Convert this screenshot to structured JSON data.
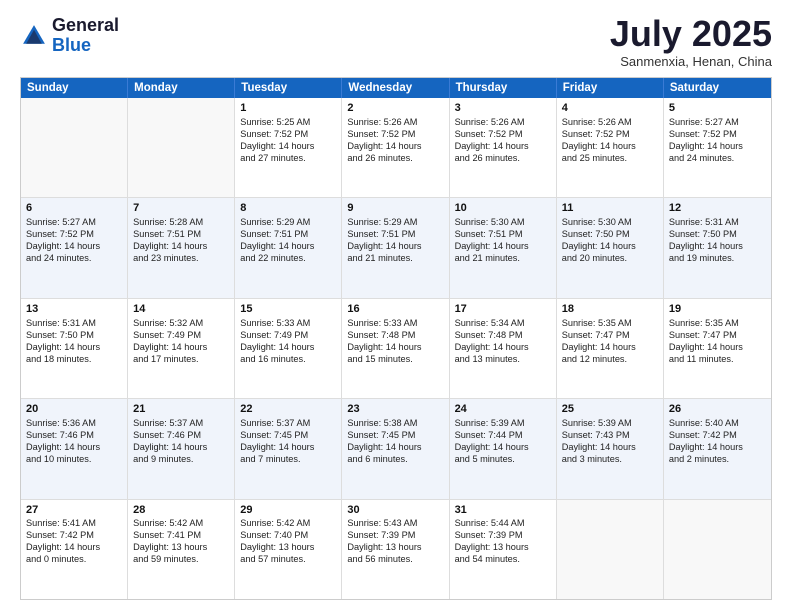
{
  "header": {
    "logo_general": "General",
    "logo_blue": "Blue",
    "month_title": "July 2025",
    "location": "Sanmenxia, Henan, China"
  },
  "days_of_week": [
    "Sunday",
    "Monday",
    "Tuesday",
    "Wednesday",
    "Thursday",
    "Friday",
    "Saturday"
  ],
  "rows": [
    [
      {
        "day": "",
        "empty": true
      },
      {
        "day": "",
        "empty": true
      },
      {
        "day": "1",
        "lines": [
          "Sunrise: 5:25 AM",
          "Sunset: 7:52 PM",
          "Daylight: 14 hours",
          "and 27 minutes."
        ]
      },
      {
        "day": "2",
        "lines": [
          "Sunrise: 5:26 AM",
          "Sunset: 7:52 PM",
          "Daylight: 14 hours",
          "and 26 minutes."
        ]
      },
      {
        "day": "3",
        "lines": [
          "Sunrise: 5:26 AM",
          "Sunset: 7:52 PM",
          "Daylight: 14 hours",
          "and 26 minutes."
        ]
      },
      {
        "day": "4",
        "lines": [
          "Sunrise: 5:26 AM",
          "Sunset: 7:52 PM",
          "Daylight: 14 hours",
          "and 25 minutes."
        ]
      },
      {
        "day": "5",
        "lines": [
          "Sunrise: 5:27 AM",
          "Sunset: 7:52 PM",
          "Daylight: 14 hours",
          "and 24 minutes."
        ]
      }
    ],
    [
      {
        "day": "6",
        "lines": [
          "Sunrise: 5:27 AM",
          "Sunset: 7:52 PM",
          "Daylight: 14 hours",
          "and 24 minutes."
        ]
      },
      {
        "day": "7",
        "lines": [
          "Sunrise: 5:28 AM",
          "Sunset: 7:51 PM",
          "Daylight: 14 hours",
          "and 23 minutes."
        ]
      },
      {
        "day": "8",
        "lines": [
          "Sunrise: 5:29 AM",
          "Sunset: 7:51 PM",
          "Daylight: 14 hours",
          "and 22 minutes."
        ]
      },
      {
        "day": "9",
        "lines": [
          "Sunrise: 5:29 AM",
          "Sunset: 7:51 PM",
          "Daylight: 14 hours",
          "and 21 minutes."
        ]
      },
      {
        "day": "10",
        "lines": [
          "Sunrise: 5:30 AM",
          "Sunset: 7:51 PM",
          "Daylight: 14 hours",
          "and 21 minutes."
        ]
      },
      {
        "day": "11",
        "lines": [
          "Sunrise: 5:30 AM",
          "Sunset: 7:50 PM",
          "Daylight: 14 hours",
          "and 20 minutes."
        ]
      },
      {
        "day": "12",
        "lines": [
          "Sunrise: 5:31 AM",
          "Sunset: 7:50 PM",
          "Daylight: 14 hours",
          "and 19 minutes."
        ]
      }
    ],
    [
      {
        "day": "13",
        "lines": [
          "Sunrise: 5:31 AM",
          "Sunset: 7:50 PM",
          "Daylight: 14 hours",
          "and 18 minutes."
        ]
      },
      {
        "day": "14",
        "lines": [
          "Sunrise: 5:32 AM",
          "Sunset: 7:49 PM",
          "Daylight: 14 hours",
          "and 17 minutes."
        ]
      },
      {
        "day": "15",
        "lines": [
          "Sunrise: 5:33 AM",
          "Sunset: 7:49 PM",
          "Daylight: 14 hours",
          "and 16 minutes."
        ]
      },
      {
        "day": "16",
        "lines": [
          "Sunrise: 5:33 AM",
          "Sunset: 7:48 PM",
          "Daylight: 14 hours",
          "and 15 minutes."
        ]
      },
      {
        "day": "17",
        "lines": [
          "Sunrise: 5:34 AM",
          "Sunset: 7:48 PM",
          "Daylight: 14 hours",
          "and 13 minutes."
        ]
      },
      {
        "day": "18",
        "lines": [
          "Sunrise: 5:35 AM",
          "Sunset: 7:47 PM",
          "Daylight: 14 hours",
          "and 12 minutes."
        ]
      },
      {
        "day": "19",
        "lines": [
          "Sunrise: 5:35 AM",
          "Sunset: 7:47 PM",
          "Daylight: 14 hours",
          "and 11 minutes."
        ]
      }
    ],
    [
      {
        "day": "20",
        "lines": [
          "Sunrise: 5:36 AM",
          "Sunset: 7:46 PM",
          "Daylight: 14 hours",
          "and 10 minutes."
        ]
      },
      {
        "day": "21",
        "lines": [
          "Sunrise: 5:37 AM",
          "Sunset: 7:46 PM",
          "Daylight: 14 hours",
          "and 9 minutes."
        ]
      },
      {
        "day": "22",
        "lines": [
          "Sunrise: 5:37 AM",
          "Sunset: 7:45 PM",
          "Daylight: 14 hours",
          "and 7 minutes."
        ]
      },
      {
        "day": "23",
        "lines": [
          "Sunrise: 5:38 AM",
          "Sunset: 7:45 PM",
          "Daylight: 14 hours",
          "and 6 minutes."
        ]
      },
      {
        "day": "24",
        "lines": [
          "Sunrise: 5:39 AM",
          "Sunset: 7:44 PM",
          "Daylight: 14 hours",
          "and 5 minutes."
        ]
      },
      {
        "day": "25",
        "lines": [
          "Sunrise: 5:39 AM",
          "Sunset: 7:43 PM",
          "Daylight: 14 hours",
          "and 3 minutes."
        ]
      },
      {
        "day": "26",
        "lines": [
          "Sunrise: 5:40 AM",
          "Sunset: 7:42 PM",
          "Daylight: 14 hours",
          "and 2 minutes."
        ]
      }
    ],
    [
      {
        "day": "27",
        "lines": [
          "Sunrise: 5:41 AM",
          "Sunset: 7:42 PM",
          "Daylight: 14 hours",
          "and 0 minutes."
        ]
      },
      {
        "day": "28",
        "lines": [
          "Sunrise: 5:42 AM",
          "Sunset: 7:41 PM",
          "Daylight: 13 hours",
          "and 59 minutes."
        ]
      },
      {
        "day": "29",
        "lines": [
          "Sunrise: 5:42 AM",
          "Sunset: 7:40 PM",
          "Daylight: 13 hours",
          "and 57 minutes."
        ]
      },
      {
        "day": "30",
        "lines": [
          "Sunrise: 5:43 AM",
          "Sunset: 7:39 PM",
          "Daylight: 13 hours",
          "and 56 minutes."
        ]
      },
      {
        "day": "31",
        "lines": [
          "Sunrise: 5:44 AM",
          "Sunset: 7:39 PM",
          "Daylight: 13 hours",
          "and 54 minutes."
        ]
      },
      {
        "day": "",
        "empty": true
      },
      {
        "day": "",
        "empty": true
      }
    ]
  ]
}
